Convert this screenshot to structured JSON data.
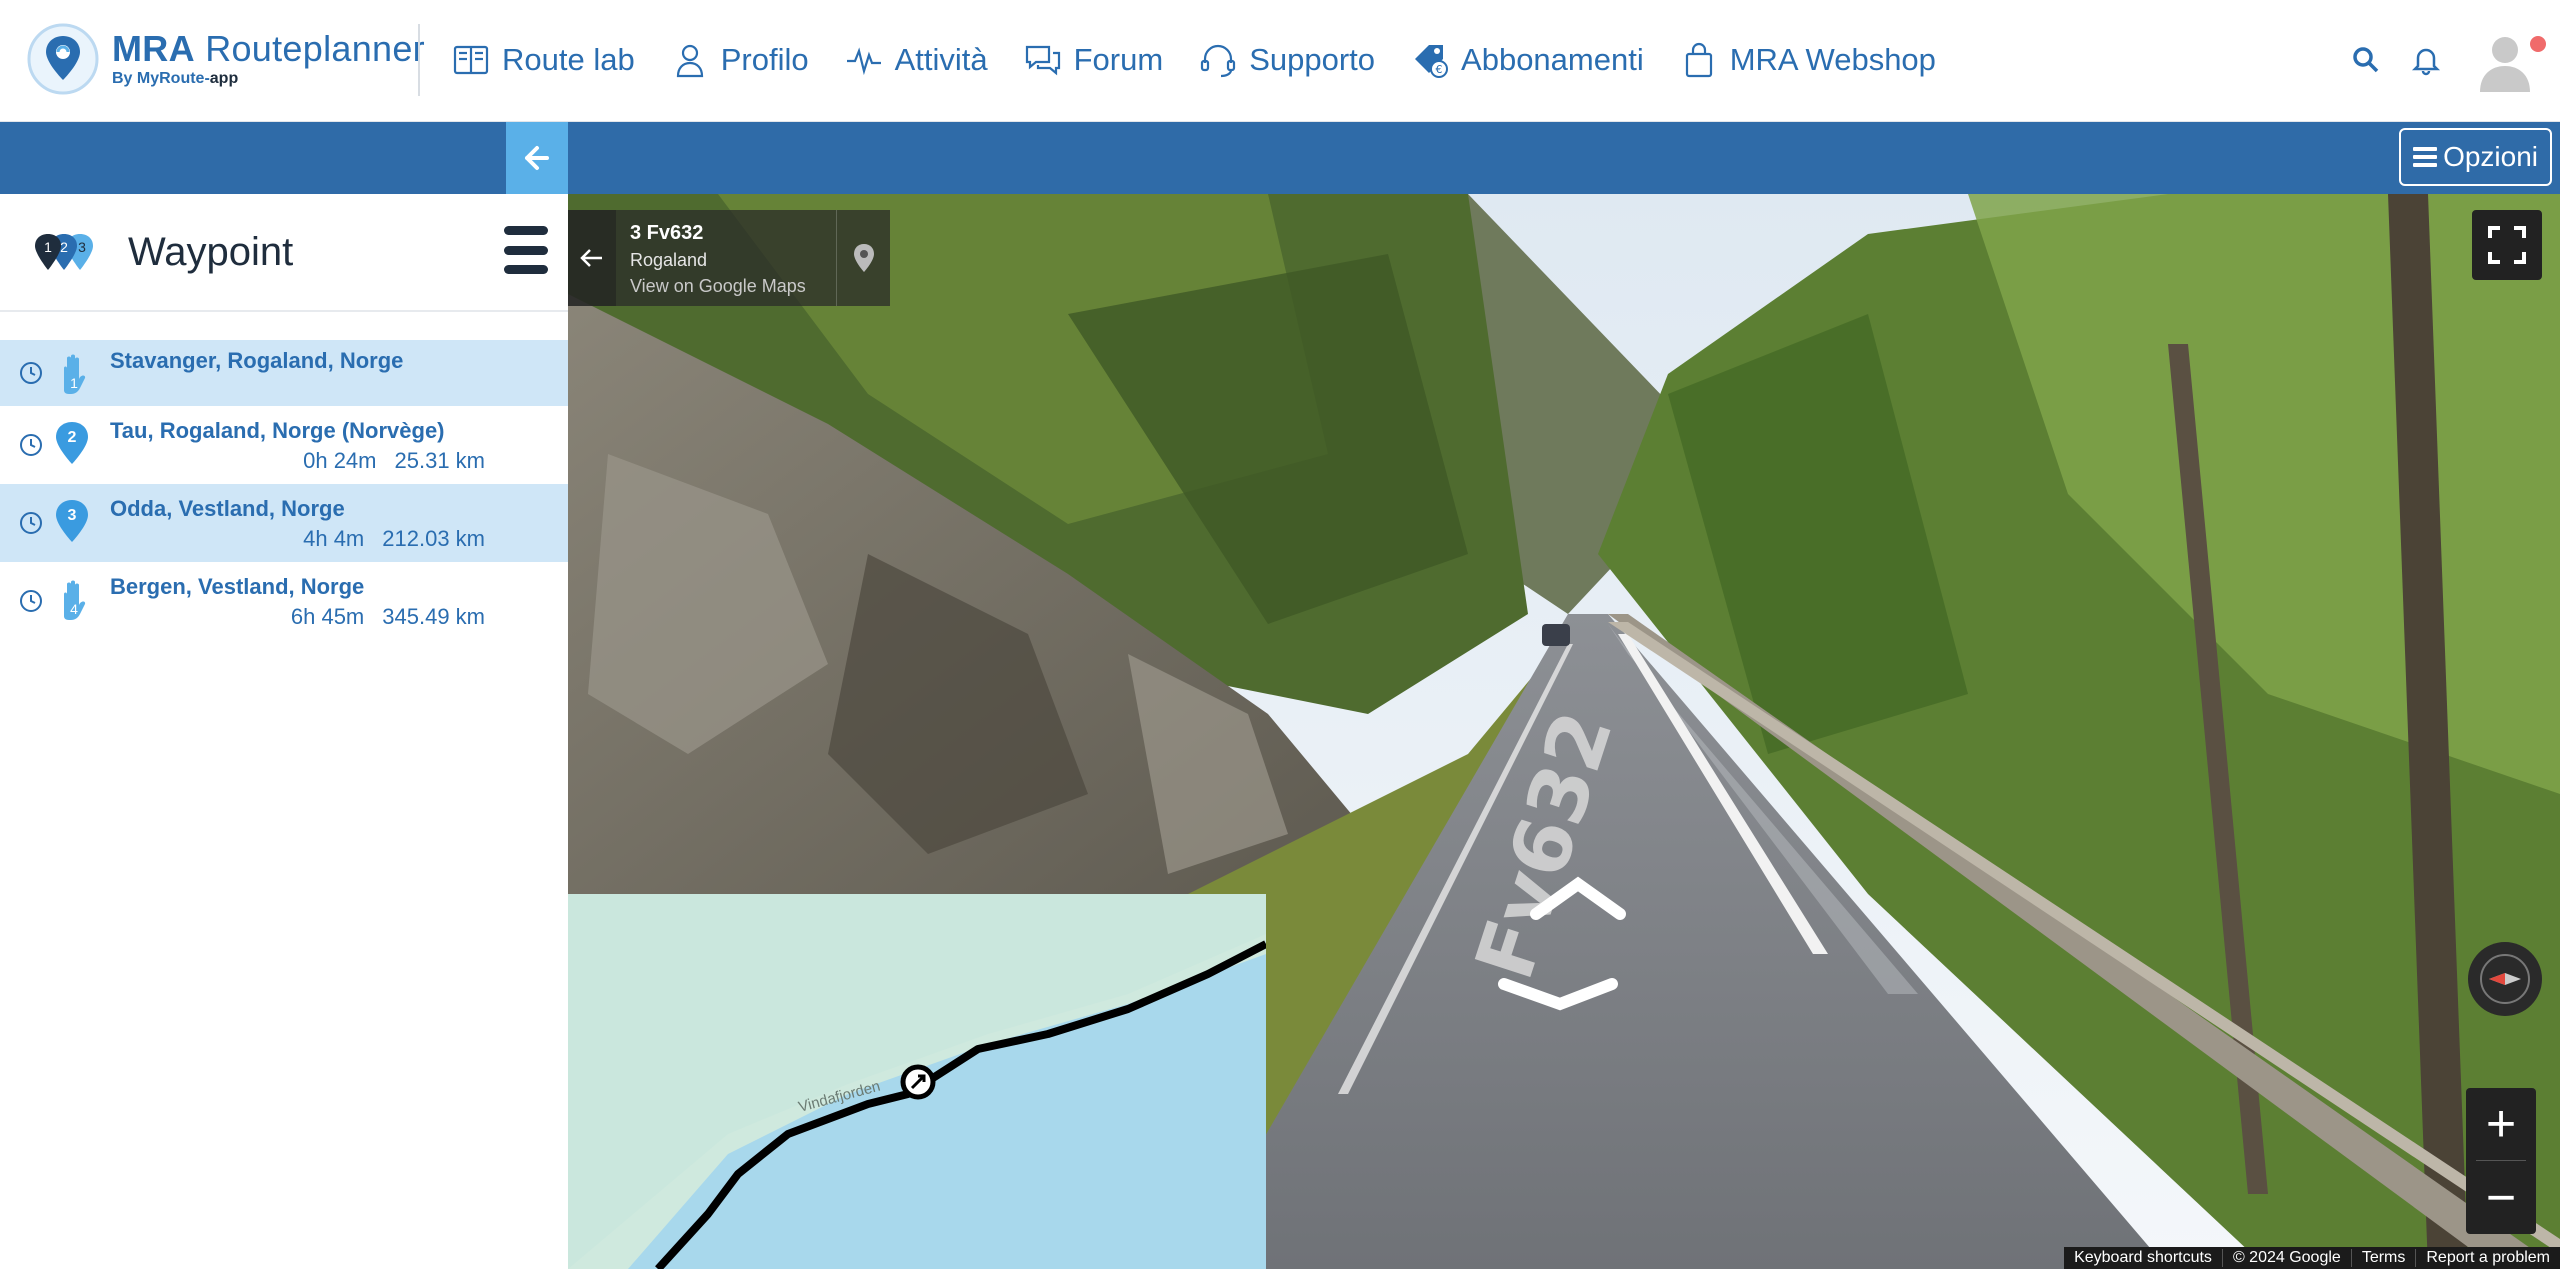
{
  "brand": {
    "title_bold": "MRA",
    "title_rest": " Routeplanner",
    "subtitle_prefix": "By MyRoute-",
    "subtitle_suffix": "app"
  },
  "nav": {
    "items": [
      {
        "label": "Route lab",
        "icon": "book-icon"
      },
      {
        "label": "Profilo",
        "icon": "user-icon"
      },
      {
        "label": "Attività",
        "icon": "activity-icon"
      },
      {
        "label": "Forum",
        "icon": "chat-icon"
      },
      {
        "label": "Supporto",
        "icon": "headset-icon"
      },
      {
        "label": "Abbonamenti",
        "icon": "tag-icon"
      },
      {
        "label": "MRA Webshop",
        "icon": "bag-icon"
      }
    ]
  },
  "toolbar": {
    "options_label": "Opzioni"
  },
  "sidebar": {
    "title": "Waypoint",
    "header_badges": [
      "1",
      "2",
      "3"
    ],
    "waypoints": [
      {
        "name": "Stavanger, Rogaland, Norge",
        "number": "1",
        "time": "",
        "distance": "",
        "kind": "hand"
      },
      {
        "name": "Tau, Rogaland, Norge (Norvège)",
        "number": "2",
        "time": "0h 24m",
        "distance": "25.31 km",
        "kind": "pin"
      },
      {
        "name": "Odda, Vestland, Norge",
        "number": "3",
        "time": "4h 4m",
        "distance": "212.03 km",
        "kind": "pin"
      },
      {
        "name": "Bergen, Vestland, Norge",
        "number": "4",
        "time": "6h 45m",
        "distance": "345.49 km",
        "kind": "hand"
      }
    ]
  },
  "streetview": {
    "road": "3 Fv632",
    "region": "Rogaland",
    "maps_link": "View on Google Maps",
    "road_marking": "Fv632",
    "attribution": [
      "Keyboard shortcuts",
      "© 2024 Google",
      "Terms",
      "Report a problem"
    ],
    "zoom_in": "+",
    "zoom_out": "−"
  },
  "minimap": {
    "place_label": "Vindafjorden"
  },
  "colors": {
    "brand_blue": "#2a6db0",
    "bar_blue": "#2f6ba8",
    "accent_light_blue": "#5ab0e8",
    "row_highlight": "#cfe6f7",
    "pin_blue": "#3a9be0"
  }
}
